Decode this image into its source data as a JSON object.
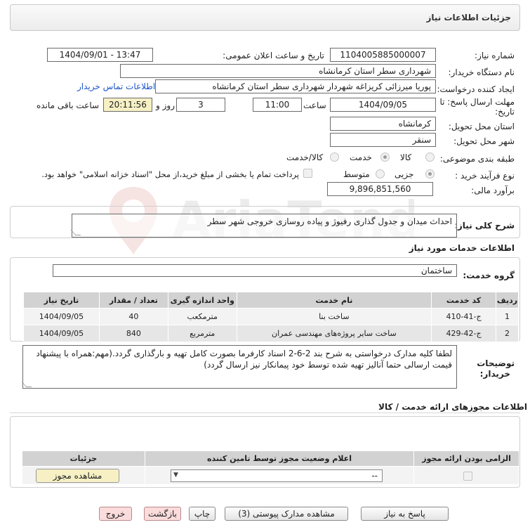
{
  "header": {
    "title": "جزئیات اطلاعات نیاز"
  },
  "form": {
    "need_number_label": "شماره نیاز:",
    "need_number": "1104005885000007",
    "announce_label": "تاریخ و ساعت اعلان عمومی:",
    "announce_value": "1404/09/01 - 13:47",
    "buyer_org_label": "نام دستگاه خریدار:",
    "buyer_org": "شهرداری سطر استان کرمانشاه",
    "requester_label": "ایجاد کننده درخواست:",
    "requester": "پوریا میرزائی کریزاغه شهردار شهرداری سطر استان کرمانشاه",
    "contact_link": "اطلاعات تماس خریدار",
    "deadline_label_1": "مهلت ارسال پاسخ: تا",
    "deadline_label_2": "تاریخ:",
    "deadline_date": "1404/09/05",
    "time_label": "ساعت",
    "deadline_time": "11:00",
    "days_value": "3",
    "days_label": "روز و",
    "remaining_time": "20:11:56",
    "remaining_label": "ساعت باقی مانده",
    "province_label": "استان محل تحویل:",
    "province": "کرمانشاه",
    "city_label": "شهر محل تحویل:",
    "city": "سنقر",
    "category_label": "طبقه بندی موضوعی:",
    "category_options": [
      "کالا",
      "خدمت",
      "کالا/خدمت"
    ],
    "process_label": "نوع فرآیند خرید :",
    "process_options": [
      "جزیی",
      "متوسط"
    ],
    "payment_note": "پرداخت تمام یا بخشی از مبلغ خرید،از محل \"اسناد خزانه اسلامی\" خواهد بود.",
    "budget_label": "برآورد مالی:",
    "budget": "9,896,851,560"
  },
  "description": {
    "label": "شرح کلی نیاز:",
    "text": "احداث میدان و جدول گذاری رفیوژ و پیاده روسازی خروجی شهر سطر"
  },
  "services": {
    "title": "اطلاعات خدمات مورد نیاز",
    "group_label": "گروه خدمت:",
    "group_value": "ساختمان",
    "columns": [
      "ردیف",
      "کد خدمت",
      "نام خدمت",
      "واحد اندازه گیری",
      "تعداد / مقدار",
      "تاریخ نیاز"
    ],
    "rows": [
      [
        "1",
        "ج-41-410",
        "ساخت بنا",
        "مترمکعب",
        "40",
        "1404/09/05"
      ],
      [
        "2",
        "ج-42-429",
        "ساخت سایر پروژه‌های مهندسی عمران",
        "مترمربع",
        "840",
        "1404/09/05"
      ]
    ]
  },
  "notes": {
    "label_1": "توضیحات",
    "label_2": "خریدار:",
    "text": "لطفا کلیه مدارک درخواستی به شرح بند 2-6-2  اسناد کارفرما بصورت کامل تهیه و بارگذاری گردد.(مهم:همراه با پیشنهاد قیمت ارسالی حتما آنالیز تهیه شده توسط خود پیمانکار نیز ارسال گردد)"
  },
  "permits": {
    "title": "اطلاعات مجوزهای ارائه خدمت / کالا",
    "columns": [
      "الزامی بودن ارائه مجوز",
      "اعلام وضعیت مجوز توسط تامین کننده",
      "جزئیات"
    ],
    "select_value": "--",
    "view_button": "مشاهده مجوز"
  },
  "footer": {
    "respond": "پاسخ به نیاز",
    "attachments": "مشاهده مدارک پیوستی (3)",
    "print": "چاپ",
    "back": "بازگشت",
    "exit": "خروج"
  },
  "watermark": "AriaTender.net"
}
